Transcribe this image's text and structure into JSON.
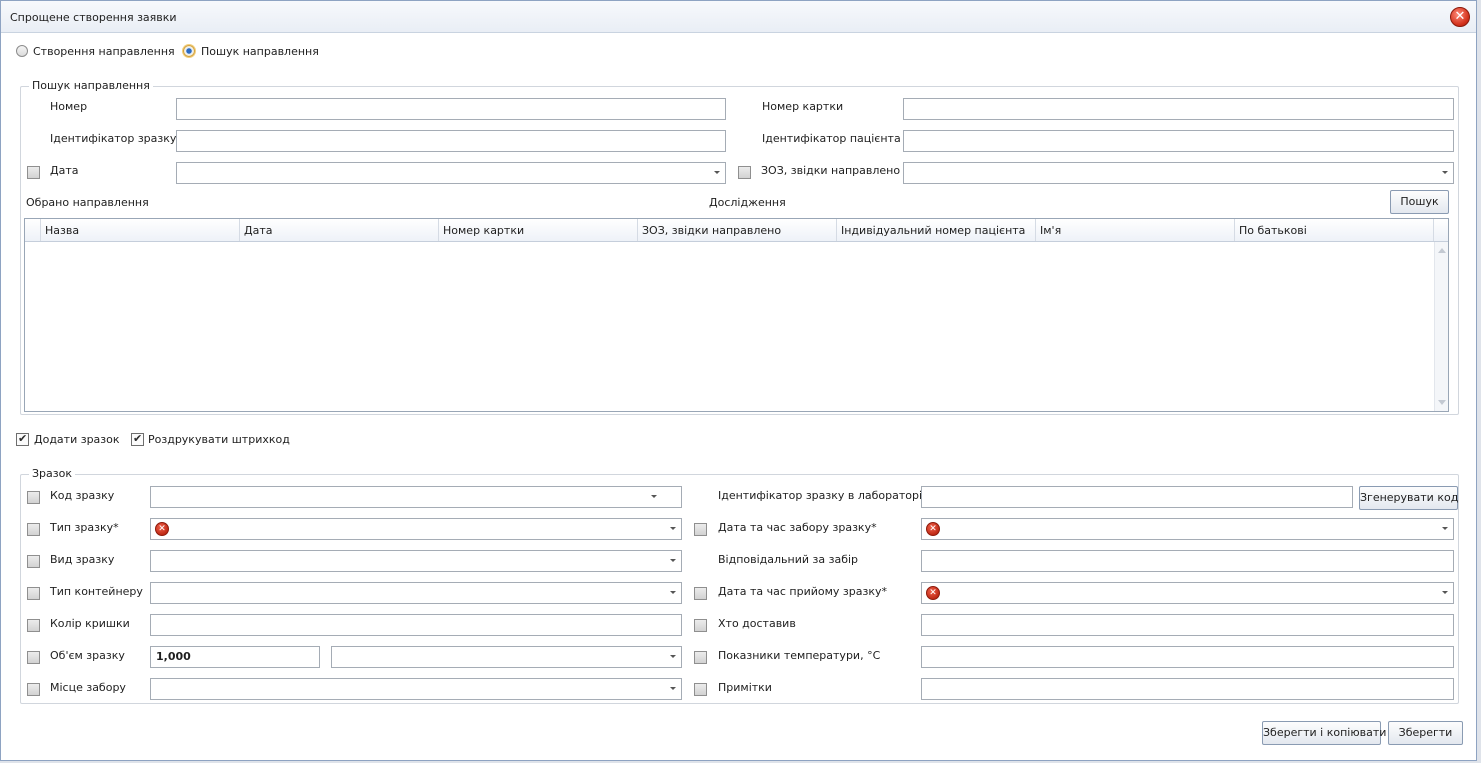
{
  "window": {
    "title": "Спрощене створення заявки"
  },
  "mode": {
    "create_label": "Створення направлення",
    "search_label": "Пошук направлення"
  },
  "search_group": {
    "title": "Пошук направлення",
    "number_label": "Номер",
    "sample_id_label": "Ідентифікатор зразку",
    "date_label": "Дата",
    "card_number_label": "Номер картки",
    "patient_id_label": "Ідентифікатор пацієнта",
    "hcf_label": "ЗОЗ, звідки направлено",
    "selected_label": "Обрано направлення",
    "research_label": "Дослідження",
    "search_button": "Пошук"
  },
  "grid": {
    "columns": [
      "Назва",
      "Дата",
      "Номер картки",
      "ЗОЗ, звідки направлено",
      "Індивідуальний номер пацієнта",
      "Ім'я",
      "По батькові"
    ]
  },
  "options": {
    "add_sample_label": "Додати зразок",
    "print_barcode_label": "Роздрукувати штрихкод"
  },
  "sample_group": {
    "title": "Зразок",
    "code_label": "Код зразку",
    "type_label": "Тип зразку*",
    "kind_label": "Вид зразку",
    "container_label": "Тип контейнеру",
    "cap_color_label": "Колір кришки",
    "volume_label": "Об'єм зразку",
    "volume_value": "1,000",
    "place_label": "Місце забору",
    "lab_id_label": "Ідентифікатор зразку в лабораторії",
    "generate_button": "Згенерувати код",
    "collect_dt_label": "Дата та час забору зразку*",
    "responsible_label": "Відповідальний за забір",
    "receive_dt_label": "Дата та час прийому зразку*",
    "delivered_label": "Хто доставив",
    "temperature_label": "Показники температури, °С",
    "notes_label": "Примітки"
  },
  "footer": {
    "save_copy_button": "Зберегти і копіювати",
    "save_button": "Зберегти"
  },
  "icons": {
    "close": "close-icon",
    "error": "error-icon"
  },
  "colors": {
    "accent": "#2b6bc4",
    "error": "#c02a16",
    "border": "#a5acb5"
  }
}
